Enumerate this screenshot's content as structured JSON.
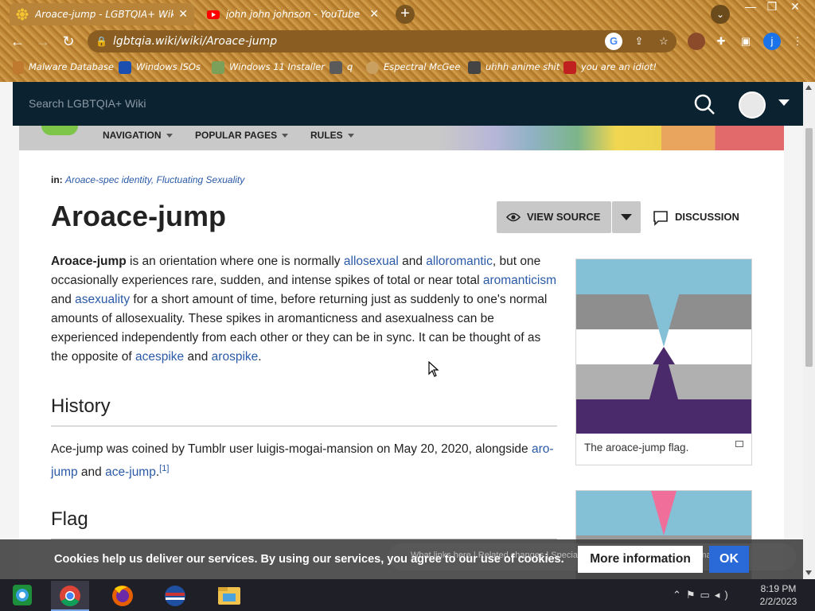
{
  "browser": {
    "tabs": [
      {
        "title": "Aroace-jump - LGBTQIA+ Wiki",
        "close": "✕"
      },
      {
        "title": "john john johnson - YouTube",
        "close": "✕"
      }
    ],
    "new_tab": "+",
    "url": "lgbtqia.wiki/wiki/Aroace-jump",
    "bookmarks": [
      "Malware Database",
      "Windows ISOs",
      "Windows 11 Installer",
      "q",
      "Espectral McGee",
      "uhhh anime shit",
      "you are an idiot!"
    ],
    "profile_initial": "j"
  },
  "wiki": {
    "search_placeholder": "Search LGBTQIA+ Wiki",
    "nav": [
      "NAVIGATION",
      "POPULAR PAGES",
      "RULES"
    ],
    "categories_label": "in:",
    "categories": "Aroace-spec identity, Fluctuating Sexuality",
    "title": "Aroace-jump",
    "view_source": "VIEW SOURCE",
    "discussion": "DISCUSSION",
    "intro": {
      "bold": "Aroace-jump",
      "t1": " is an orientation where one is normally ",
      "l1": "allosexual",
      "t2": " and ",
      "l2": "alloromantic",
      "t3": ", but one occasionally experiences rare, sudden, and intense spikes of total or near total ",
      "l3": "aromanticism",
      "t4": " and ",
      "l4": "asexuality",
      "t5": " for a short amount of time, before returning just as suddenly to one's normal amounts of allosexuality. These spikes in aromanticness and asexualness can be experienced independently from each other or they can be in sync. It can be thought of as the opposite of ",
      "l5": "acespike",
      "t6": " and ",
      "l6": "arospike",
      "t7": "."
    },
    "history_heading": "History",
    "history": {
      "t1": "Ace-jump was coined by Tumblr user luigis-mogai-mansion on May 20, 2020, alongside ",
      "l1": "aro-jump",
      "t2": " and ",
      "l2": "ace-jump",
      "t3": ".",
      "ref": "[1]"
    },
    "flag_heading": "Flag",
    "flag_caption": "The aroace-jump flag.",
    "flag_colors": [
      "#84c0d6",
      "#8e8e8e",
      "#ffffff",
      "#b0b0b0",
      "#4a2a6a",
      "#ef6f9a"
    ]
  },
  "cookie": {
    "ghost_links": "What links here  |  Related changes  |  Special pages  |  Printable version  |  Permanent link",
    "text": "Cookies help us deliver our services. By using our services, you agree to our use of cookies.",
    "more_info": "More information",
    "ok": "OK"
  },
  "taskbar": {
    "time": "8:19 PM",
    "date": "2/2/2023"
  }
}
